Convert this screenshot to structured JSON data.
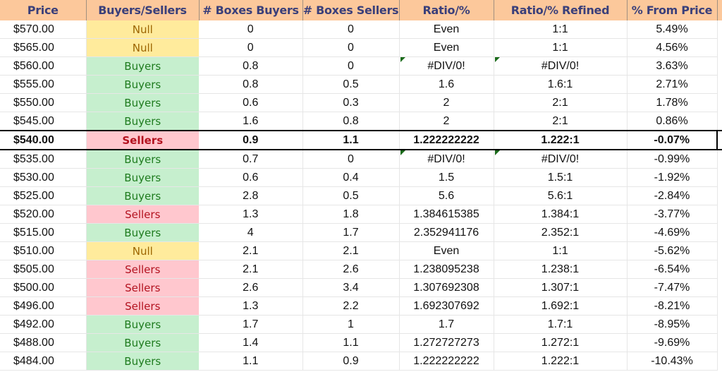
{
  "sheet": {
    "headers": [
      "Price",
      "Buyers/Sellers",
      "# Boxes Buyers",
      "# Boxes Sellers",
      "Ratio/%",
      "Ratio/% Refined",
      "% From Price"
    ],
    "highlighted_row_index": 6,
    "status_colors": {
      "Buyers": {
        "fill": "#c6efce",
        "text": "#1e7b1e"
      },
      "Sellers": {
        "fill": "#ffc7ce",
        "text": "#b3121f"
      },
      "Null": {
        "fill": "#ffeb9c",
        "text": "#9c6500"
      }
    },
    "rows": [
      {
        "price": "$570.00",
        "side": "Null",
        "boxes_buyers": "0",
        "boxes_sellers": "0",
        "ratio": "Even",
        "ratio_refined": "1:1",
        "pct_from_price": "5.49%",
        "error_flag": false
      },
      {
        "price": "$565.00",
        "side": "Null",
        "boxes_buyers": "0",
        "boxes_sellers": "0",
        "ratio": "Even",
        "ratio_refined": "1:1",
        "pct_from_price": "4.56%",
        "error_flag": false
      },
      {
        "price": "$560.00",
        "side": "Buyers",
        "boxes_buyers": "0.8",
        "boxes_sellers": "0",
        "ratio": "#DIV/0!",
        "ratio_refined": "#DIV/0!",
        "pct_from_price": "3.63%",
        "error_flag": true
      },
      {
        "price": "$555.00",
        "side": "Buyers",
        "boxes_buyers": "0.8",
        "boxes_sellers": "0.5",
        "ratio": "1.6",
        "ratio_refined": "1.6:1",
        "pct_from_price": "2.71%",
        "error_flag": false
      },
      {
        "price": "$550.00",
        "side": "Buyers",
        "boxes_buyers": "0.6",
        "boxes_sellers": "0.3",
        "ratio": "2",
        "ratio_refined": "2:1",
        "pct_from_price": "1.78%",
        "error_flag": false
      },
      {
        "price": "$545.00",
        "side": "Buyers",
        "boxes_buyers": "1.6",
        "boxes_sellers": "0.8",
        "ratio": "2",
        "ratio_refined": "2:1",
        "pct_from_price": "0.86%",
        "error_flag": false
      },
      {
        "price": "$540.00",
        "side": "Sellers",
        "boxes_buyers": "0.9",
        "boxes_sellers": "1.1",
        "ratio": "1.222222222",
        "ratio_refined": "1.222:1",
        "pct_from_price": "-0.07%",
        "error_flag": false
      },
      {
        "price": "$535.00",
        "side": "Buyers",
        "boxes_buyers": "0.7",
        "boxes_sellers": "0",
        "ratio": "#DIV/0!",
        "ratio_refined": "#DIV/0!",
        "pct_from_price": "-0.99%",
        "error_flag": true
      },
      {
        "price": "$530.00",
        "side": "Buyers",
        "boxes_buyers": "0.6",
        "boxes_sellers": "0.4",
        "ratio": "1.5",
        "ratio_refined": "1.5:1",
        "pct_from_price": "-1.92%",
        "error_flag": false
      },
      {
        "price": "$525.00",
        "side": "Buyers",
        "boxes_buyers": "2.8",
        "boxes_sellers": "0.5",
        "ratio": "5.6",
        "ratio_refined": "5.6:1",
        "pct_from_price": "-2.84%",
        "error_flag": false
      },
      {
        "price": "$520.00",
        "side": "Sellers",
        "boxes_buyers": "1.3",
        "boxes_sellers": "1.8",
        "ratio": "1.384615385",
        "ratio_refined": "1.384:1",
        "pct_from_price": "-3.77%",
        "error_flag": false
      },
      {
        "price": "$515.00",
        "side": "Buyers",
        "boxes_buyers": "4",
        "boxes_sellers": "1.7",
        "ratio": "2.352941176",
        "ratio_refined": "2.352:1",
        "pct_from_price": "-4.69%",
        "error_flag": false
      },
      {
        "price": "$510.00",
        "side": "Null",
        "boxes_buyers": "2.1",
        "boxes_sellers": "2.1",
        "ratio": "Even",
        "ratio_refined": "1:1",
        "pct_from_price": "-5.62%",
        "error_flag": false
      },
      {
        "price": "$505.00",
        "side": "Sellers",
        "boxes_buyers": "2.1",
        "boxes_sellers": "2.6",
        "ratio": "1.238095238",
        "ratio_refined": "1.238:1",
        "pct_from_price": "-6.54%",
        "error_flag": false
      },
      {
        "price": "$500.00",
        "side": "Sellers",
        "boxes_buyers": "2.6",
        "boxes_sellers": "3.4",
        "ratio": "1.307692308",
        "ratio_refined": "1.307:1",
        "pct_from_price": "-7.47%",
        "error_flag": false
      },
      {
        "price": "$496.00",
        "side": "Sellers",
        "boxes_buyers": "1.3",
        "boxes_sellers": "2.2",
        "ratio": "1.692307692",
        "ratio_refined": "1.692:1",
        "pct_from_price": "-8.21%",
        "error_flag": false
      },
      {
        "price": "$492.00",
        "side": "Buyers",
        "boxes_buyers": "1.7",
        "boxes_sellers": "1",
        "ratio": "1.7",
        "ratio_refined": "1.7:1",
        "pct_from_price": "-8.95%",
        "error_flag": false
      },
      {
        "price": "$488.00",
        "side": "Buyers",
        "boxes_buyers": "1.4",
        "boxes_sellers": "1.1",
        "ratio": "1.272727273",
        "ratio_refined": "1.272:1",
        "pct_from_price": "-9.69%",
        "error_flag": false
      },
      {
        "price": "$484.00",
        "side": "Buyers",
        "boxes_buyers": "1.1",
        "boxes_sellers": "0.9",
        "ratio": "1.222222222",
        "ratio_refined": "1.222:1",
        "pct_from_price": "-10.43%",
        "error_flag": false
      }
    ]
  }
}
